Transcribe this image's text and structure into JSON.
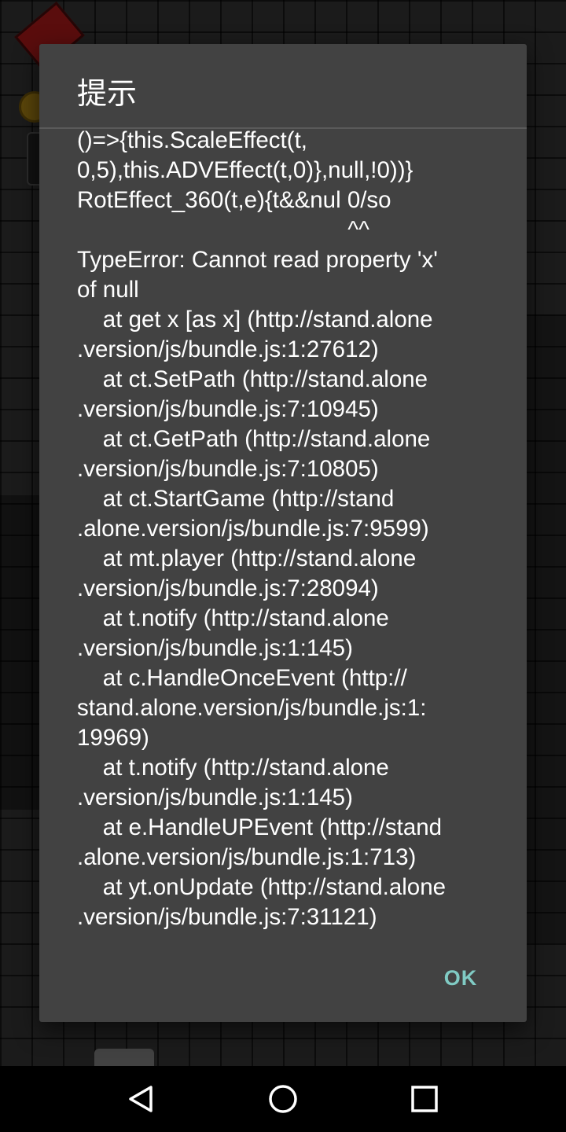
{
  "dialog": {
    "title": "提示",
    "message": "()=>{this.ScaleEffect(t,\n0,5),this.ADVEffect(t,0)},null,!0))}\nRotEffect_360(t,e){t&&nul 0/so\n                                          ^^\nTypeError: Cannot read property 'x'\nof null\n    at get x [as x] (http://stand.alone\n.version/js/bundle.js:1:27612)\n    at ct.SetPath (http://stand.alone\n.version/js/bundle.js:7:10945)\n    at ct.GetPath (http://stand.alone\n.version/js/bundle.js:7:10805)\n    at ct.StartGame (http://stand\n.alone.version/js/bundle.js:7:9599)\n    at mt.player (http://stand.alone\n.version/js/bundle.js:7:28094)\n    at t.notify (http://stand.alone\n.version/js/bundle.js:1:145)\n    at c.HandleOnceEvent (http://\nstand.alone.version/js/bundle.js:1:\n19969)\n    at t.notify (http://stand.alone\n.version/js/bundle.js:1:145)\n    at e.HandleUPEvent (http://stand\n.alone.version/js/bundle.js:1:713)\n    at yt.onUpdate (http://stand.alone\n.version/js/bundle.js:7:31121)",
    "ok_label": "OK"
  },
  "navbar": {
    "back_icon": "back-triangle-icon",
    "home_icon": "home-circle-icon",
    "recents_icon": "recents-square-icon"
  },
  "colors": {
    "dialog_background": "#424242",
    "accent": "#80cbc4",
    "text": "#ffffff"
  }
}
